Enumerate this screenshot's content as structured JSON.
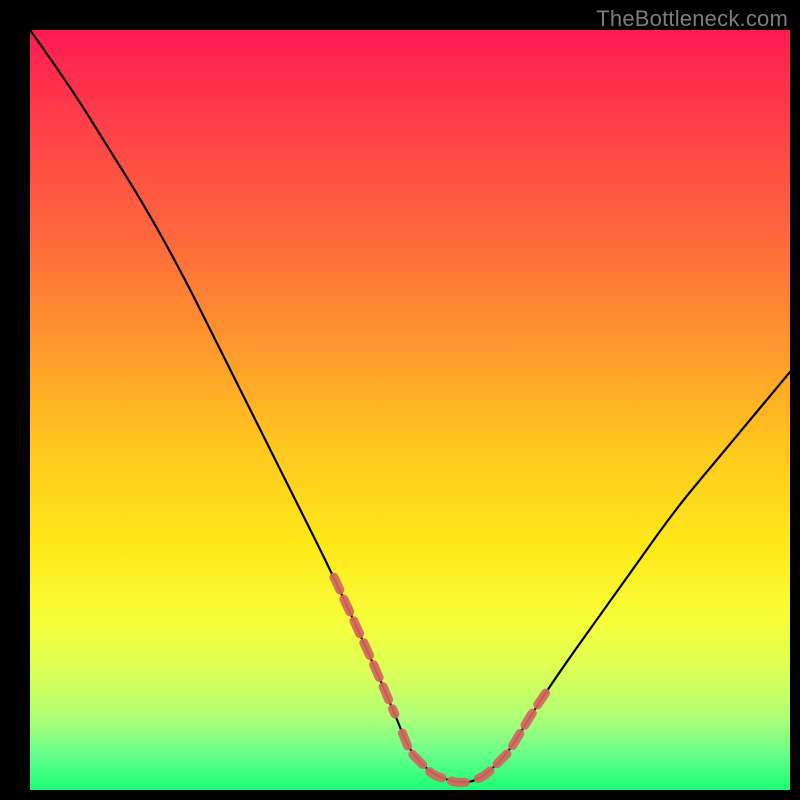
{
  "watermark": "TheBottleneck.com",
  "colors": {
    "frame": "#000000",
    "gradient_top": "#ff1a52",
    "gradient_bottom": "#1bff74",
    "curve_stroke": "#000000",
    "band_stroke": "#d5655e"
  },
  "chart_data": {
    "type": "line",
    "title": "",
    "xlabel": "",
    "ylabel": "",
    "xlim": [
      0,
      100
    ],
    "ylim": [
      0,
      100
    ],
    "note": "Unlabeled axes. x and y read as percent of plot width/height, y=0 at bottom. Curve is a V-shape with minimum ~0 around x≈50–58; left arm steep from top-left, right arm shallower ending near y≈55 at right edge.",
    "series": [
      {
        "name": "curve",
        "x": [
          0,
          5,
          10,
          15,
          20,
          25,
          30,
          35,
          40,
          45,
          48,
          50,
          53,
          56,
          58,
          60,
          63,
          66,
          70,
          75,
          80,
          85,
          90,
          95,
          100
        ],
        "y": [
          100,
          93,
          85,
          77,
          68,
          58,
          48,
          38,
          28,
          17,
          10,
          5,
          2,
          1,
          1,
          2,
          5,
          10,
          16,
          23,
          30,
          37,
          43,
          49,
          55
        ]
      }
    ],
    "highlight_bands": {
      "note": "Pink dashed overlay segments near bottom of V on both arms and across trough.",
      "segments_x": [
        [
          40,
          48
        ],
        [
          49,
          58
        ],
        [
          59,
          68
        ]
      ]
    }
  }
}
